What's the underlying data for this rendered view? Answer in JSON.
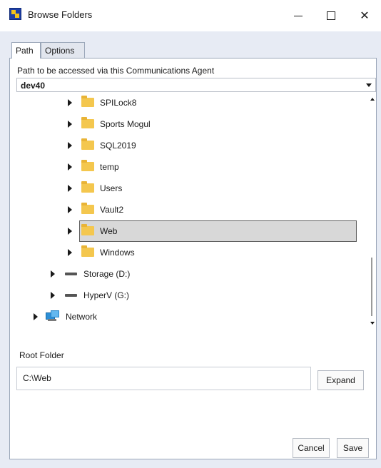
{
  "window": {
    "title": "Browse Folders",
    "icon": "app-icon"
  },
  "tabs": [
    {
      "label": "Path",
      "active": true
    },
    {
      "label": "Options",
      "active": false
    }
  ],
  "path_section": {
    "label": "Path to be accessed via this Communications Agent",
    "selected_agent": "dev40"
  },
  "tree": {
    "items": [
      {
        "label": "SPILock8",
        "icon": "folder-icon",
        "level": 2,
        "selected": false
      },
      {
        "label": "Sports Mogul",
        "icon": "folder-icon",
        "level": 2,
        "selected": false
      },
      {
        "label": "SQL2019",
        "icon": "folder-icon",
        "level": 2,
        "selected": false
      },
      {
        "label": "temp",
        "icon": "folder-icon",
        "level": 2,
        "selected": false
      },
      {
        "label": "Users",
        "icon": "folder-icon",
        "level": 2,
        "selected": false
      },
      {
        "label": "Vault2",
        "icon": "folder-icon",
        "level": 2,
        "selected": false
      },
      {
        "label": "Web",
        "icon": "folder-icon",
        "level": 2,
        "selected": true
      },
      {
        "label": "Windows",
        "icon": "folder-icon",
        "level": 2,
        "selected": false
      },
      {
        "label": "Storage (D:)",
        "icon": "drive-icon",
        "level": 1,
        "selected": false
      },
      {
        "label": "HyperV (G:)",
        "icon": "drive-icon",
        "level": 1,
        "selected": false
      },
      {
        "label": "Network",
        "icon": "network-icon",
        "level": 0,
        "selected": false
      }
    ]
  },
  "root_folder": {
    "label": "Root Folder",
    "value": "C:\\Web",
    "expand_label": "Expand"
  },
  "footer": {
    "cancel_label": "Cancel",
    "save_label": "Save"
  }
}
